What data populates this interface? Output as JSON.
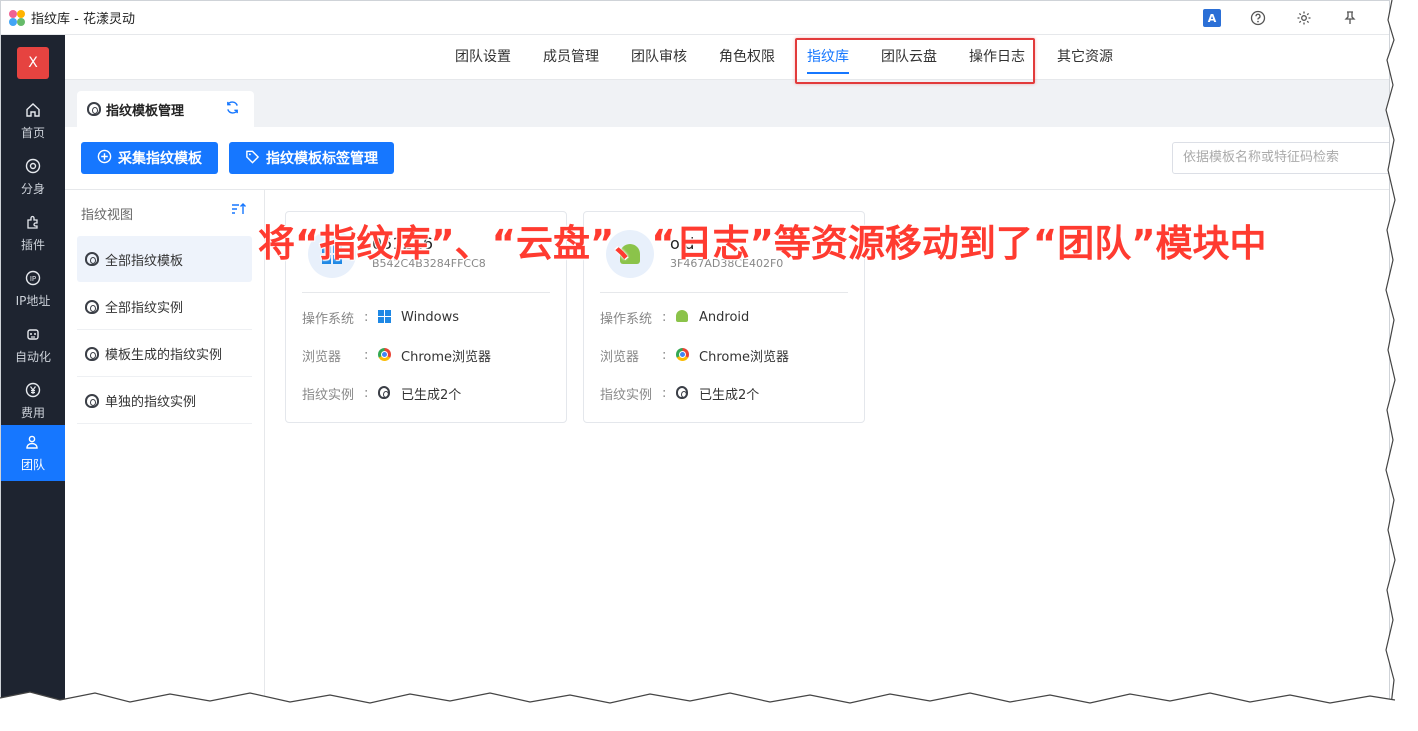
{
  "window": {
    "title": "指纹库 - 花漾灵动"
  },
  "titlebar": {
    "icons": [
      "translate-icon",
      "help-icon",
      "gear-icon",
      "pin-icon"
    ],
    "translate_label": "A"
  },
  "sidebar": {
    "brand": "X",
    "items": [
      {
        "label": "首页",
        "icon": "home-icon"
      },
      {
        "label": "分身",
        "icon": "chrome-like-icon"
      },
      {
        "label": "插件",
        "icon": "puzzle-icon"
      },
      {
        "label": "IP地址",
        "icon": "ip-icon"
      },
      {
        "label": "自动化",
        "icon": "robot-icon"
      },
      {
        "label": "费用",
        "icon": "yen-icon"
      },
      {
        "label": "团队",
        "icon": "team-icon"
      }
    ],
    "active": "团队"
  },
  "topnav": {
    "tabs": [
      "团队设置",
      "成员管理",
      "团队审核",
      "角色权限",
      "指纹库",
      "团队云盘",
      "操作日志",
      "其它资源"
    ],
    "active": "指纹库"
  },
  "pagetab": {
    "label": "指纹模板管理"
  },
  "toolbar": {
    "collect_label": "采集指纹模板",
    "tag_label": "指纹模板标签管理",
    "search_placeholder": "依据模板名称或特征码检索"
  },
  "leftpanel": {
    "title": "指纹视图",
    "items": [
      "全部指纹模板",
      "全部指纹实例",
      "模板生成的指纹实例",
      "单独的指纹实例"
    ],
    "active": "全部指纹模板"
  },
  "cards": [
    {
      "name": "051216",
      "code": "B542C4B3284FFCC8",
      "os_label": "操作系统",
      "os": "Windows",
      "browser_label": "浏览器",
      "browser": "Chrome浏览器",
      "instance_label": "指纹实例",
      "instances": "已生成2个"
    },
    {
      "name": "oid",
      "code": "3F467AD38CE402F0",
      "os_label": "操作系统",
      "os": "Android",
      "browser_label": "浏览器",
      "browser": "Chrome浏览器",
      "instance_label": "指纹实例",
      "instances": "已生成2个"
    }
  ],
  "annotation": "将“指纹库”、“云盘”、“日志”等资源移动到了“团队”模块中",
  "colors": {
    "accent": "#1677ff",
    "sidebar_bg": "#1e2430",
    "highlight": "#e23b3b",
    "annotation": "#ff3b30"
  }
}
